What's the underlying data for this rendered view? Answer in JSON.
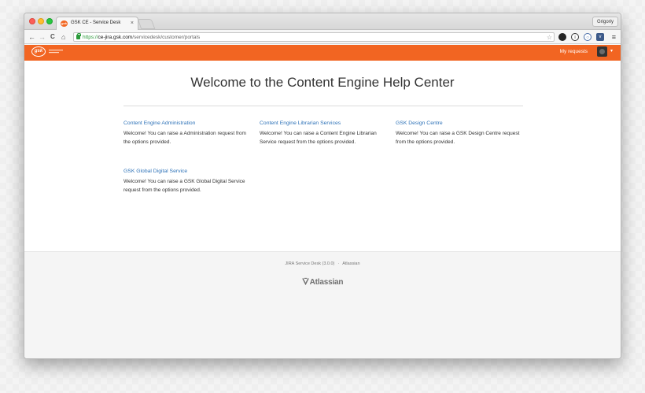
{
  "browser": {
    "tab_title": "GSK CE - Service Desk",
    "tab_close": "×",
    "profile_name": "Grigoriy",
    "url": {
      "scheme": "https://",
      "host": "ce-jira.gsk.com",
      "path": "/servicedesk/customer/portals"
    },
    "nav": {
      "back": "←",
      "forward": "→",
      "reload": "C",
      "home": "⌂"
    },
    "menu_glyph": "≡",
    "star_glyph": "☆"
  },
  "header": {
    "brand_logo_text": "gsk",
    "my_requests_label": "My requests",
    "avatar_caret": "▾",
    "accent_color": "#f26522"
  },
  "main": {
    "title": "Welcome to the Content Engine Help Center",
    "portals": [
      {
        "name": "Content Engine Administration",
        "description": "Welcome! You can raise a Administration request from the options provided."
      },
      {
        "name": "Content Engine Librarian Services",
        "description": "Welcome! You can raise a Content Engine Librarian Service request from the options provided."
      },
      {
        "name": "GSK Design Centre",
        "description": "Welcome! You can raise a GSK Design Centre request from the options provided."
      },
      {
        "name": "GSK Global Digital Service",
        "description": "Welcome! You can raise a GSK Global Digital Service request from the options provided."
      }
    ],
    "link_color": "#2f73b8"
  },
  "footer": {
    "product": "JIRA Service Desk (3.0.0)",
    "separator": "·",
    "vendor": "Atlassian",
    "logo_text": "Atlassian"
  }
}
